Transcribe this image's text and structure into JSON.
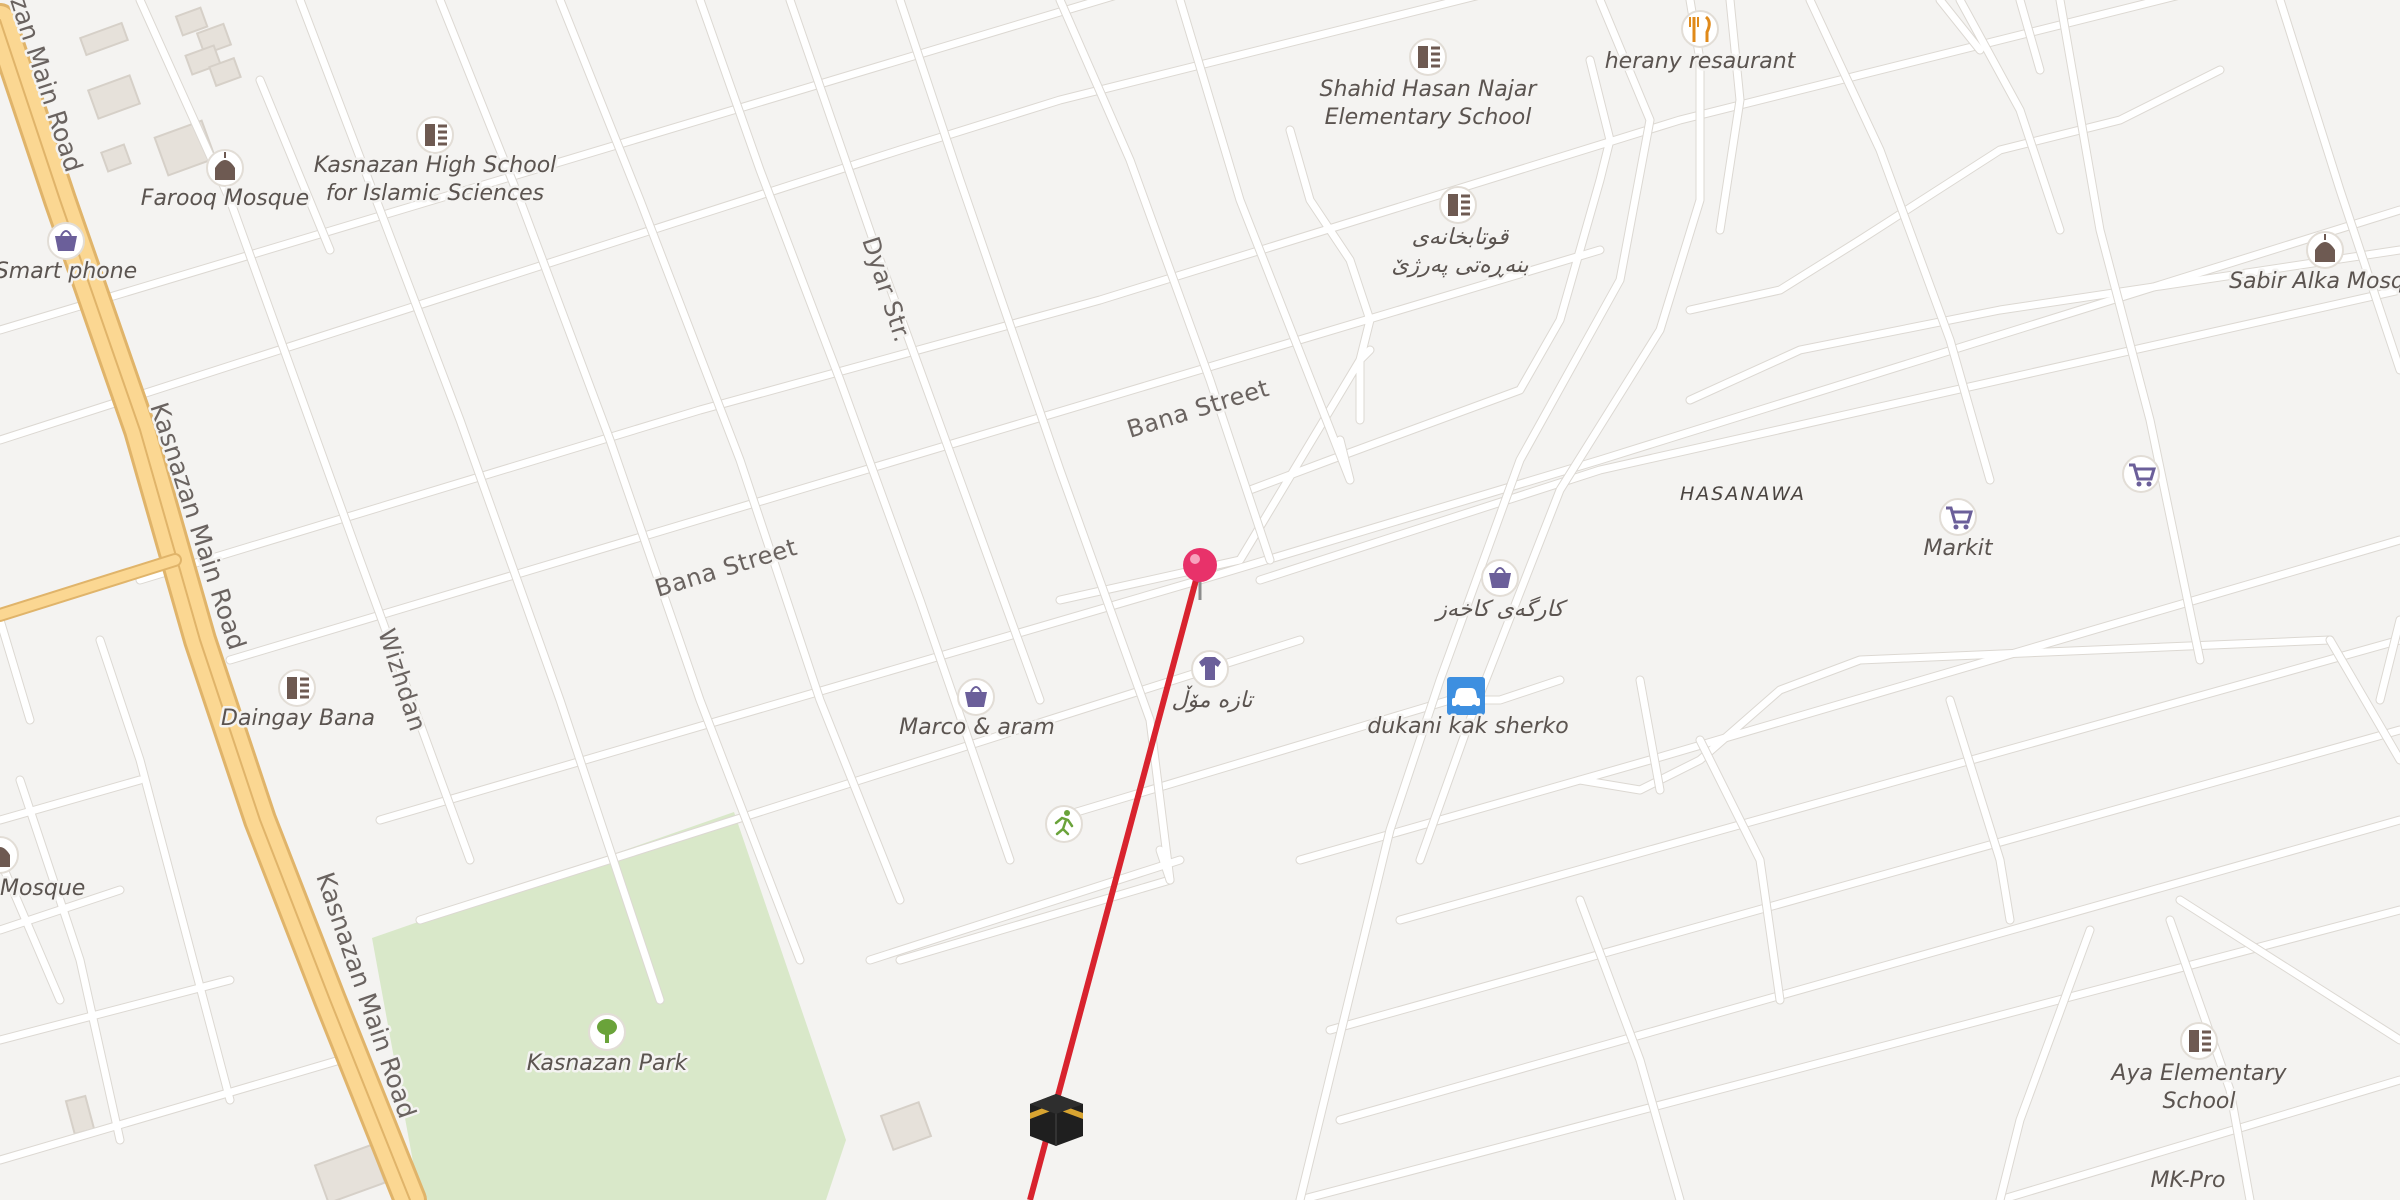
{
  "map": {
    "area_label": "HASANAWA",
    "streets": {
      "bana_street_1": "Bana Street",
      "bana_street_2": "Bana Street",
      "dyar_str": "Dyar Str.",
      "wizhdan": "Wizhdan",
      "kasnazan_main_road_1": "Kasnazan Main Road",
      "kasnazan_main_road_2": "Kasnazan Main Road",
      "kasnazan_main_road_3": "zan Main Road"
    },
    "pois": {
      "shahid_school": {
        "name_line1": "Shahid Hasan Najar",
        "name_line2": "Elementary School",
        "icon": "school-icon"
      },
      "herany_restaurant": {
        "name": "herany resaurant",
        "icon": "restaurant-icon"
      },
      "kurdish_school": {
        "name_line1": "قوتابخانەی",
        "name_line2": "بنەڕەتی پەرژێ",
        "icon": "school-icon"
      },
      "kasnazan_high_school": {
        "name_line1": "Kasnazan High School",
        "name_line2": "for Islamic Sciences",
        "icon": "school-icon"
      },
      "farooq_mosque": {
        "name": "Farooq Mosque",
        "icon": "mosque-icon"
      },
      "smart_phone": {
        "name": "Smart phone",
        "icon": "shopping-bag-icon"
      },
      "sabir_alka_mosque": {
        "name": "Sabir Alka Mosq",
        "icon": "mosque-icon"
      },
      "markit": {
        "name": "Markit",
        "icon": "cart-icon"
      },
      "cart_east": {
        "icon": "cart-icon"
      },
      "karga_shop": {
        "name": "کارگەی کاخەز",
        "icon": "shopping-bag-icon"
      },
      "dukani_kak_sherko": {
        "name": "dukani kak sherko",
        "icon": "car-icon"
      },
      "taza_mol": {
        "name": "تازە مۆڵ",
        "icon": "clothes-icon"
      },
      "marco_aram": {
        "name": "Marco & aram",
        "icon": "shopping-bag-icon"
      },
      "daingay_bana": {
        "name": "Daingay Bana",
        "icon": "school-icon"
      },
      "mosque_west": {
        "name": "Mosque",
        "icon": "mosque-icon"
      },
      "sports": {
        "icon": "sports-icon"
      },
      "kasnazan_park": {
        "name": "Kasnazan Park",
        "icon": "tree-icon"
      },
      "aya_school": {
        "name_line1": "Aya Elementary",
        "name_line2": "School",
        "icon": "school-icon"
      },
      "mk_pro": {
        "name": "MK-Pro"
      },
      "kaaba": {
        "icon": "kaaba-icon"
      }
    },
    "pin": {
      "icon": "location-pin-icon",
      "color": "#e8326a"
    },
    "qibla_line": {
      "color": "#d8232e"
    },
    "colors": {
      "background": "#f4f3f1",
      "minor_road": "#ffffff",
      "main_road": "#fbd792",
      "main_road_case": "#e0b46a",
      "park": "#d9e8c9",
      "poi_icon": "#6b5f9a",
      "school_icon": "#6e5a52",
      "car_marker": "#3d8fe0",
      "tree_icon": "#6aa33a"
    }
  }
}
